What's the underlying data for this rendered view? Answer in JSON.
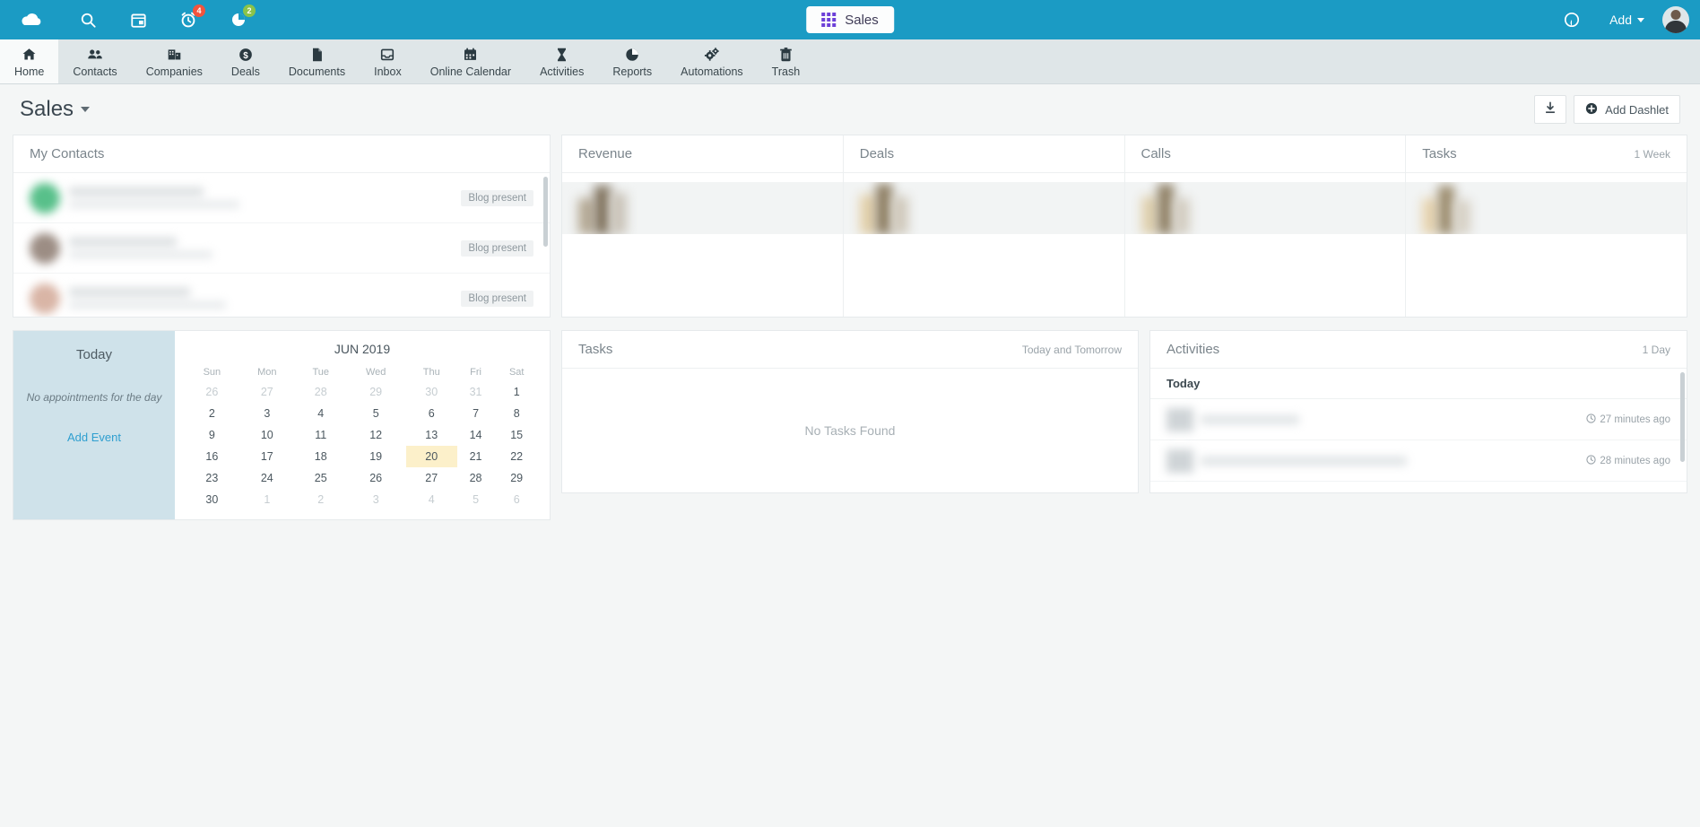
{
  "topbar": {
    "logo_icon": "cloud-icon",
    "items": [
      {
        "name": "search-icon",
        "badge": null
      },
      {
        "name": "calendar-icon",
        "badge": null
      },
      {
        "name": "alarm-clock-icon",
        "badge": "4",
        "badge_color": "#f2543d"
      },
      {
        "name": "pie-chart-icon",
        "badge": "2",
        "badge_color": "#8bc34a"
      }
    ],
    "app_switcher": {
      "label": "Sales",
      "icon": "grid-icon"
    },
    "help_icon": "help-circle-icon",
    "add_label": "Add",
    "avatar": "user-avatar",
    "background": "#1b9bc4"
  },
  "nav": {
    "items": [
      {
        "label": "Home",
        "icon": "home-icon",
        "active": true
      },
      {
        "label": "Contacts",
        "icon": "people-icon",
        "active": false
      },
      {
        "label": "Companies",
        "icon": "building-icon",
        "active": false
      },
      {
        "label": "Deals",
        "icon": "dollar-circle-icon",
        "active": false
      },
      {
        "label": "Documents",
        "icon": "document-icon",
        "active": false
      },
      {
        "label": "Inbox",
        "icon": "inbox-icon",
        "active": false
      },
      {
        "label": "Online Calendar",
        "icon": "calendar-icon",
        "active": false
      },
      {
        "label": "Activities",
        "icon": "hourglass-icon",
        "active": false
      },
      {
        "label": "Reports",
        "icon": "pie-chart-icon",
        "active": false
      },
      {
        "label": "Automations",
        "icon": "gears-icon",
        "active": false
      },
      {
        "label": "Trash",
        "icon": "trash-icon",
        "active": false
      }
    ]
  },
  "page": {
    "title": "Sales",
    "download_icon": "download-icon",
    "add_dashlet_label": "Add Dashlet",
    "add_dashlet_icon": "plus-circle-icon"
  },
  "dashlets": {
    "my_contacts": {
      "title": "My Contacts",
      "rows": [
        {
          "tag": "Blog present"
        },
        {
          "tag": "Blog present"
        },
        {
          "tag": "Blog present"
        }
      ]
    },
    "kpis": [
      {
        "title": "Revenue",
        "meta": ""
      },
      {
        "title": "Deals",
        "meta": ""
      },
      {
        "title": "Calls",
        "meta": ""
      },
      {
        "title": "Tasks",
        "meta": "1 Week"
      }
    ],
    "calendar": {
      "today_label": "Today",
      "no_appointments": "No appointments for the day",
      "add_event_label": "Add Event",
      "month_label": "JUN 2019",
      "weekdays": [
        "Sun",
        "Mon",
        "Tue",
        "Wed",
        "Thu",
        "Fri",
        "Sat"
      ],
      "weeks": [
        [
          {
            "d": "26",
            "out": true
          },
          {
            "d": "27",
            "out": true
          },
          {
            "d": "28",
            "out": true
          },
          {
            "d": "29",
            "out": true
          },
          {
            "d": "30",
            "out": true
          },
          {
            "d": "31",
            "out": true
          },
          {
            "d": "1",
            "out": false
          }
        ],
        [
          {
            "d": "2",
            "out": false
          },
          {
            "d": "3",
            "out": false
          },
          {
            "d": "4",
            "out": false
          },
          {
            "d": "5",
            "out": false
          },
          {
            "d": "6",
            "out": false
          },
          {
            "d": "7",
            "out": false
          },
          {
            "d": "8",
            "out": false
          }
        ],
        [
          {
            "d": "9",
            "out": false
          },
          {
            "d": "10",
            "out": false
          },
          {
            "d": "11",
            "out": false
          },
          {
            "d": "12",
            "out": false
          },
          {
            "d": "13",
            "out": false
          },
          {
            "d": "14",
            "out": false
          },
          {
            "d": "15",
            "out": false
          }
        ],
        [
          {
            "d": "16",
            "out": false
          },
          {
            "d": "17",
            "out": false
          },
          {
            "d": "18",
            "out": false
          },
          {
            "d": "19",
            "out": false
          },
          {
            "d": "20",
            "out": false,
            "today": true
          },
          {
            "d": "21",
            "out": false
          },
          {
            "d": "22",
            "out": false
          }
        ],
        [
          {
            "d": "23",
            "out": false
          },
          {
            "d": "24",
            "out": false
          },
          {
            "d": "25",
            "out": false
          },
          {
            "d": "26",
            "out": false
          },
          {
            "d": "27",
            "out": false
          },
          {
            "d": "28",
            "out": false
          },
          {
            "d": "29",
            "out": false
          }
        ],
        [
          {
            "d": "30",
            "out": false
          },
          {
            "d": "1",
            "out": true
          },
          {
            "d": "2",
            "out": true
          },
          {
            "d": "3",
            "out": true
          },
          {
            "d": "4",
            "out": true
          },
          {
            "d": "5",
            "out": true
          },
          {
            "d": "6",
            "out": true
          }
        ]
      ],
      "highlight_color": "#fcf0ca"
    },
    "tasks": {
      "title": "Tasks",
      "meta": "Today and Tomorrow",
      "empty_text": "No Tasks Found"
    },
    "activities": {
      "title": "Activities",
      "meta": "1 Day",
      "group_label": "Today",
      "rows": [
        {
          "time": "27 minutes ago",
          "icon": "clock-icon"
        },
        {
          "time": "28 minutes ago",
          "icon": "clock-icon"
        }
      ]
    }
  }
}
